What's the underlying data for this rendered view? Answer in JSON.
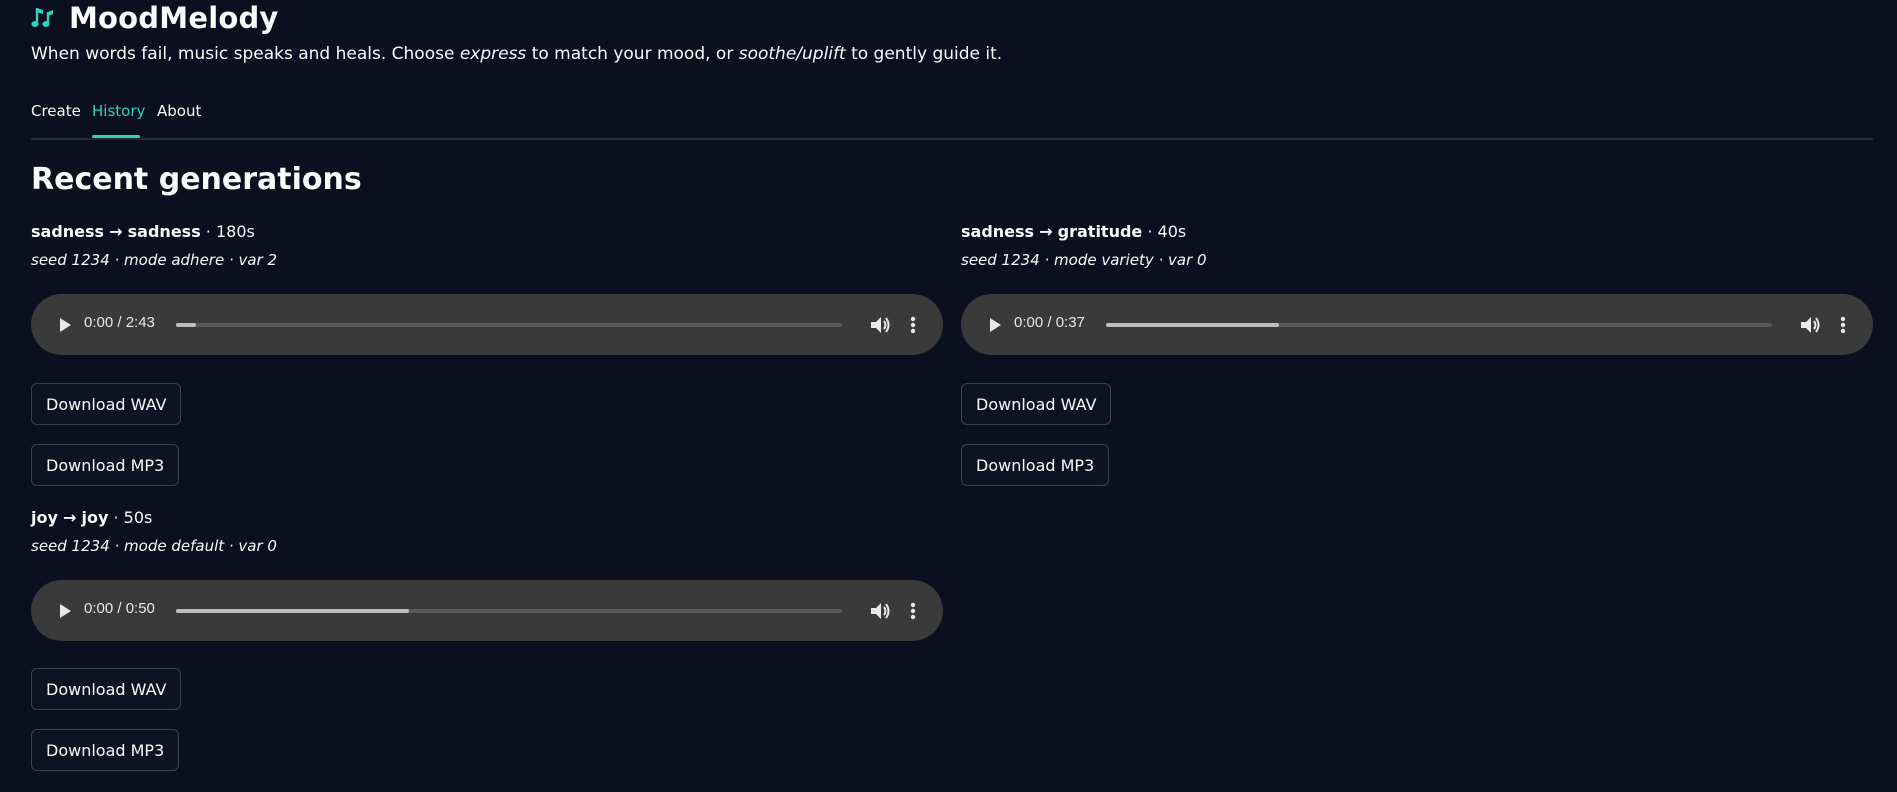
{
  "app": {
    "title": "MoodMelody",
    "subtitle_part1": "When words fail, music speaks and heals. Choose ",
    "subtitle_em1": "express",
    "subtitle_part2": " to match your mood, or ",
    "subtitle_em2": "soothe/uplift",
    "subtitle_part3": " to gently guide it.",
    "accent_color": "#2dd4bf",
    "icon": "music-notes-icon"
  },
  "tabs": [
    {
      "label": "Create",
      "active": false
    },
    {
      "label": "History",
      "active": true
    },
    {
      "label": "About",
      "active": false
    }
  ],
  "section_title": "Recent generations",
  "generations": [
    {
      "from": "sadness",
      "arrow": "→",
      "to": "sadness",
      "duration": " · 180s",
      "meta": "seed 1234 · mode adhere · var 2",
      "time": "0:00 / 2:43",
      "buffered": 0.03,
      "download_wav": "Download WAV",
      "download_mp3": "Download MP3"
    },
    {
      "from": "sadness",
      "arrow": "→",
      "to": "gratitude",
      "duration": " · 40s",
      "meta": "seed 1234 · mode variety · var 0",
      "time": "0:00 / 0:37",
      "buffered": 0.26,
      "download_wav": "Download WAV",
      "download_mp3": "Download MP3"
    },
    {
      "from": "joy",
      "arrow": "→",
      "to": "joy",
      "duration": " · 50s",
      "meta": "seed 1234 · mode default · var 0",
      "time": "0:00 / 0:50",
      "buffered": 0.35,
      "download_wav": "Download WAV",
      "download_mp3": "Download MP3"
    }
  ]
}
